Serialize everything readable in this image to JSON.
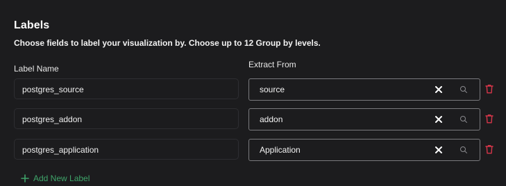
{
  "header": {
    "title": "Labels",
    "subtitle": "Choose fields to label your visualization by. Choose up to 12 Group by levels."
  },
  "columns": {
    "label_name": "Label Name",
    "extract_from": "Extract From"
  },
  "rows": [
    {
      "label_name": "postgres_source",
      "extract_from": "source"
    },
    {
      "label_name": "postgres_addon",
      "extract_from": "addon"
    },
    {
      "label_name": "postgres_application",
      "extract_from": "Application"
    }
  ],
  "actions": {
    "add_label": "Add New Label"
  },
  "icons": {
    "clear": "close-icon",
    "search": "search-icon",
    "delete": "trash-icon",
    "add": "plus-icon"
  },
  "colors": {
    "background": "#1c1c1e",
    "accent_green": "#3fa46a",
    "delete_red": "#d9364a"
  }
}
